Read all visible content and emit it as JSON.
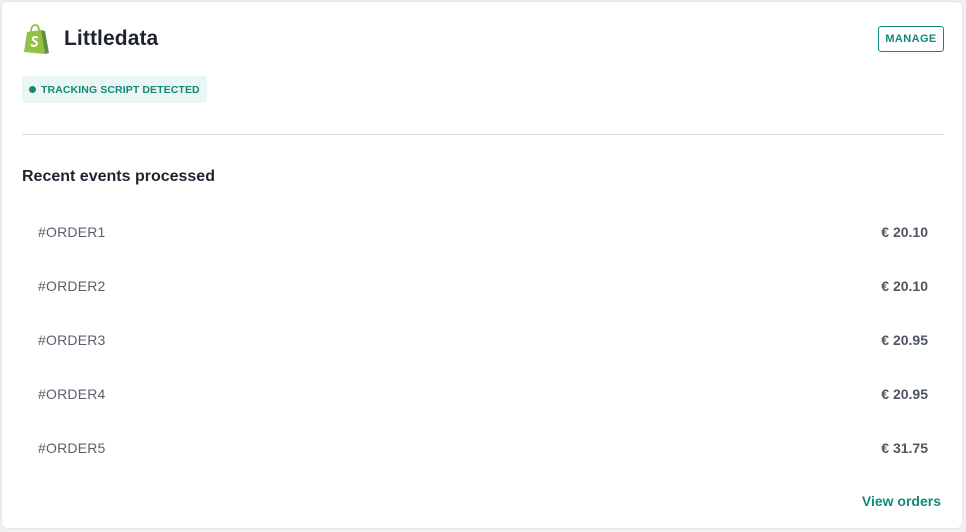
{
  "header": {
    "brand": "Littledata",
    "logo_icon": "shopify-bag-icon",
    "manage_label": "MANAGE"
  },
  "status_badge": {
    "label": "TRACKING SCRIPT DETECTED",
    "color": "#13897a",
    "background": "#eaf6f3"
  },
  "recent_events": {
    "title": "Recent events processed",
    "items": [
      {
        "id": "#ORDER1",
        "amount": "€ 20.10"
      },
      {
        "id": "#ORDER2",
        "amount": "€ 20.10"
      },
      {
        "id": "#ORDER3",
        "amount": "€ 20.95"
      },
      {
        "id": "#ORDER4",
        "amount": "€ 20.95"
      },
      {
        "id": "#ORDER5",
        "amount": "€ 31.75"
      }
    ]
  },
  "footer": {
    "view_orders_label": "View orders"
  },
  "colors": {
    "accent": "#13897a",
    "shopify_green": "#95bf47",
    "text_primary": "#1f2430"
  }
}
